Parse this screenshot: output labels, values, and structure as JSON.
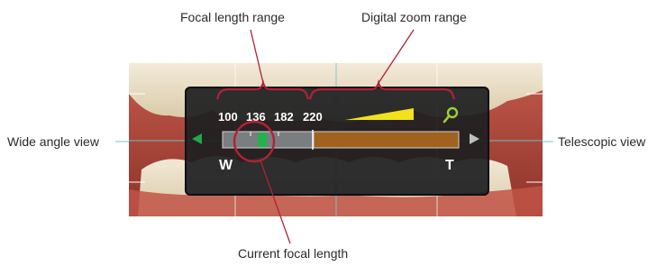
{
  "callouts": {
    "focal_length_range": "Focal length range",
    "digital_zoom_range": "Digital zoom range",
    "wide_angle_view": "Wide angle view",
    "telescopic_view": "Telescopic view",
    "current_focal_length": "Current focal length"
  },
  "zoom_indicator": {
    "focal_marks": [
      "100",
      "136",
      "182",
      "220"
    ],
    "wide_label": "W",
    "tele_label": "T",
    "current_focal_length": 136,
    "zoom_icon": "magnifier-icon",
    "left_arrow_icon": "triangle-left-icon",
    "right_arrow_icon": "triangle-right-icon"
  },
  "colors": {
    "callout_red": "#b22234",
    "left_arrow": "#1fa84f",
    "current_marker": "#22b24c",
    "digital_zoom_bar": "#a0621e",
    "zoom_wedge": "#f2e21c",
    "zoom_icon": "#9ccf3a",
    "right_arrow": "#bfbfbf"
  }
}
